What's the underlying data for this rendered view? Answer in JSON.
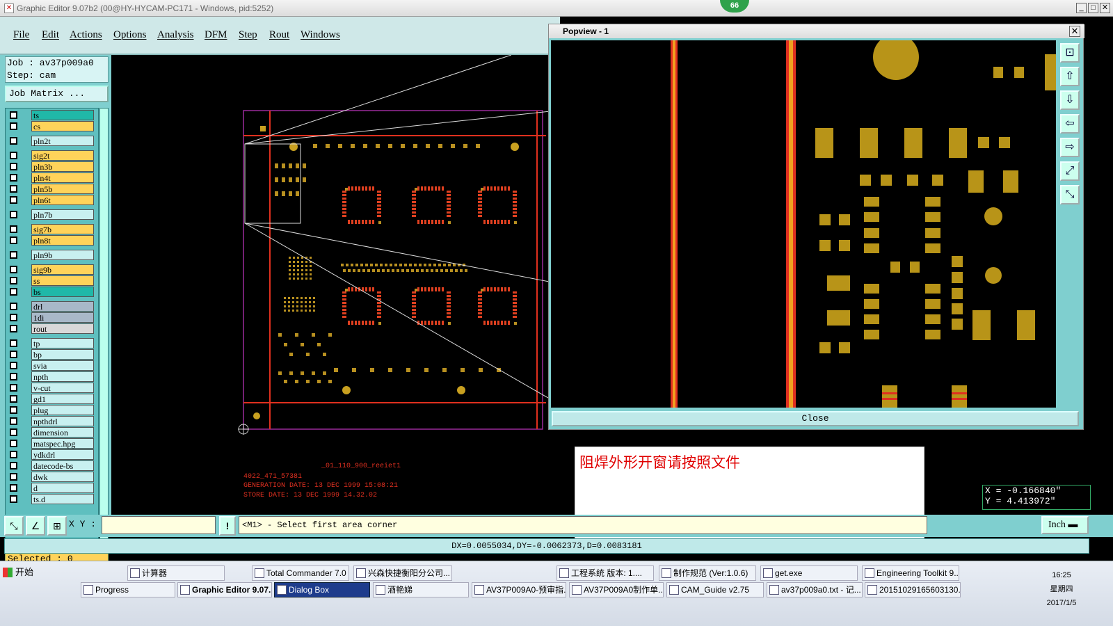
{
  "window": {
    "title": "Graphic Editor 9.07b2 (00@HY-HYCAM-PC171 - Windows, pid:5252)",
    "badge": "66"
  },
  "menu": [
    "File",
    "Edit",
    "Actions",
    "Options",
    "Analysis",
    "DFM",
    "Step",
    "Rout",
    "Windows"
  ],
  "job": {
    "job_line": "Job : av37p009a0",
    "step_line": "Step: cam",
    "matrix_button": "Job Matrix ..."
  },
  "layers": [
    {
      "name": "ts",
      "color": "#20b8a8"
    },
    {
      "name": "cs",
      "color": "#ffd35a"
    },
    {
      "name": "pln2t",
      "color": "#c8f0f0"
    },
    {
      "name": "sig2t",
      "color": "#ffd35a"
    },
    {
      "name": "pln3b",
      "color": "#ffd35a"
    },
    {
      "name": "pln4t",
      "color": "#ffd35a"
    },
    {
      "name": "pln5b",
      "color": "#ffd35a"
    },
    {
      "name": "pln6t",
      "color": "#ffd35a"
    },
    {
      "name": "pln7b",
      "color": "#c8f0f0"
    },
    {
      "name": "sig7b",
      "color": "#ffd35a"
    },
    {
      "name": "pln8t",
      "color": "#ffd35a"
    },
    {
      "name": "pln9b",
      "color": "#c8f0f0"
    },
    {
      "name": "sig9b",
      "color": "#ffd35a"
    },
    {
      "name": "ss",
      "color": "#ffd35a"
    },
    {
      "name": "bs",
      "color": "#20b8a8"
    },
    {
      "name": "drl",
      "color": "#a8b8c8"
    },
    {
      "name": "1di",
      "color": "#a8b8c8"
    },
    {
      "name": "rout",
      "color": "#d8d8d8"
    },
    {
      "name": "tp",
      "color": "#c8f0f0"
    },
    {
      "name": "bp",
      "color": "#c8f0f0"
    },
    {
      "name": "svia",
      "color": "#c8f0f0"
    },
    {
      "name": "npth",
      "color": "#c8f0f0"
    },
    {
      "name": "v-cut",
      "color": "#c8f0f0"
    },
    {
      "name": "gd1",
      "color": "#c8f0f0"
    },
    {
      "name": "plug",
      "color": "#c8f0f0"
    },
    {
      "name": "npthdrl",
      "color": "#c8f0f0"
    },
    {
      "name": "dimension",
      "color": "#c8f0f0"
    },
    {
      "name": "matspec.hpg",
      "color": "#c8f0f0"
    },
    {
      "name": "ydkdrl",
      "color": "#c8f0f0"
    },
    {
      "name": "datecode-bs",
      "color": "#c8f0f0"
    },
    {
      "name": "dwk",
      "color": "#c8f0f0"
    },
    {
      "name": "d",
      "color": "#c8f0f0"
    },
    {
      "name": "ts.d",
      "color": "#c8f0f0"
    }
  ],
  "selected": "Selected : 0",
  "canvas_text": {
    "line1": "_01_110_900_reeiet1",
    "line2": "4022_471_57381",
    "line3": "GENERATION DATE: 13 DEC 1999 15:08:21",
    "line4": "STORE DATE: 13 DEC 1999 14.32.02"
  },
  "popview": {
    "title": "Popview - 1",
    "close_label": "Close"
  },
  "note": "阻焊外形开窗请按照文件",
  "coords": {
    "x": "X = -0.166840\"",
    "y": "Y = 4.413972\""
  },
  "command": {
    "xy_label": "X Y :",
    "xy_value": "",
    "prompt": "<M1> - Select first area corner",
    "units": "Inch"
  },
  "status": "DX=0.0055034,DY=-0.0062373,D=0.0083181",
  "taskbar": {
    "start": "开始",
    "row1": [
      "计算器",
      "Total Commander 7.0 ...",
      "兴森快捷衡阳分公司...",
      "工程系统  版本: 1....",
      "制作规范 (Ver:1.0.6)",
      "get.exe",
      "Engineering Toolkit 9...."
    ],
    "row2": [
      "Progress",
      "Graphic Editor 9.07...",
      "Dialog Box",
      "酒艳娣",
      "AV37P009A0-预审指...",
      "AV37P009A0制作单....",
      "CAM_Guide v2.75",
      "av37p009a0.txt - 记...",
      "20151029165603130..."
    ],
    "time": "16:25",
    "weekday": "星期四",
    "date": "2017/1/5"
  }
}
